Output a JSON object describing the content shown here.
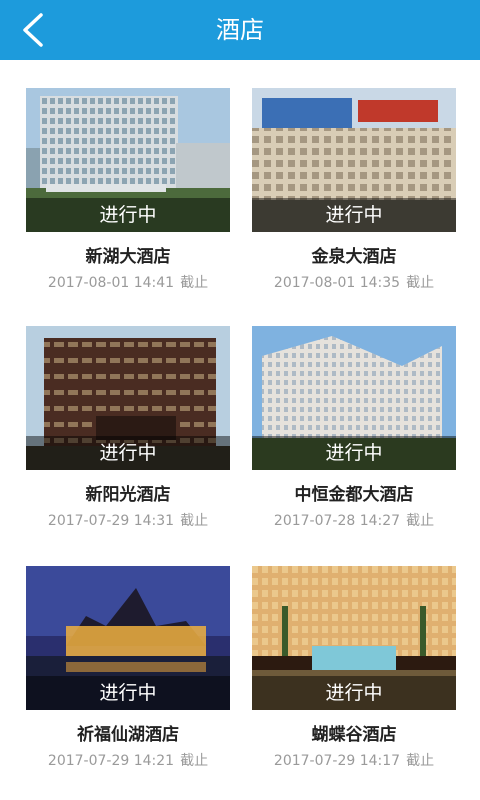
{
  "header": {
    "title": "酒店",
    "back_icon": "chevron-left-icon"
  },
  "colors": {
    "header_bg": "#1d9bdc",
    "status_overlay": "rgba(0,0,0,0.45)"
  },
  "hotels": [
    {
      "name": "新湖大酒店",
      "status": "进行中",
      "deadline": "2017-08-01 14:41",
      "deadline_suffix": "截止"
    },
    {
      "name": "金泉大酒店",
      "status": "进行中",
      "deadline": "2017-08-01 14:35",
      "deadline_suffix": "截止"
    },
    {
      "name": "新阳光酒店",
      "status": "进行中",
      "deadline": "2017-07-29 14:31",
      "deadline_suffix": "截止"
    },
    {
      "name": "中恒金都大酒店",
      "status": "进行中",
      "deadline": "2017-07-28 14:27",
      "deadline_suffix": "截止"
    },
    {
      "name": "祈福仙湖酒店",
      "status": "进行中",
      "deadline": "2017-07-29 14:21",
      "deadline_suffix": "截止"
    },
    {
      "name": "蝴蝶谷酒店",
      "status": "进行中",
      "deadline": "2017-07-29 14:17",
      "deadline_suffix": "截止"
    }
  ]
}
